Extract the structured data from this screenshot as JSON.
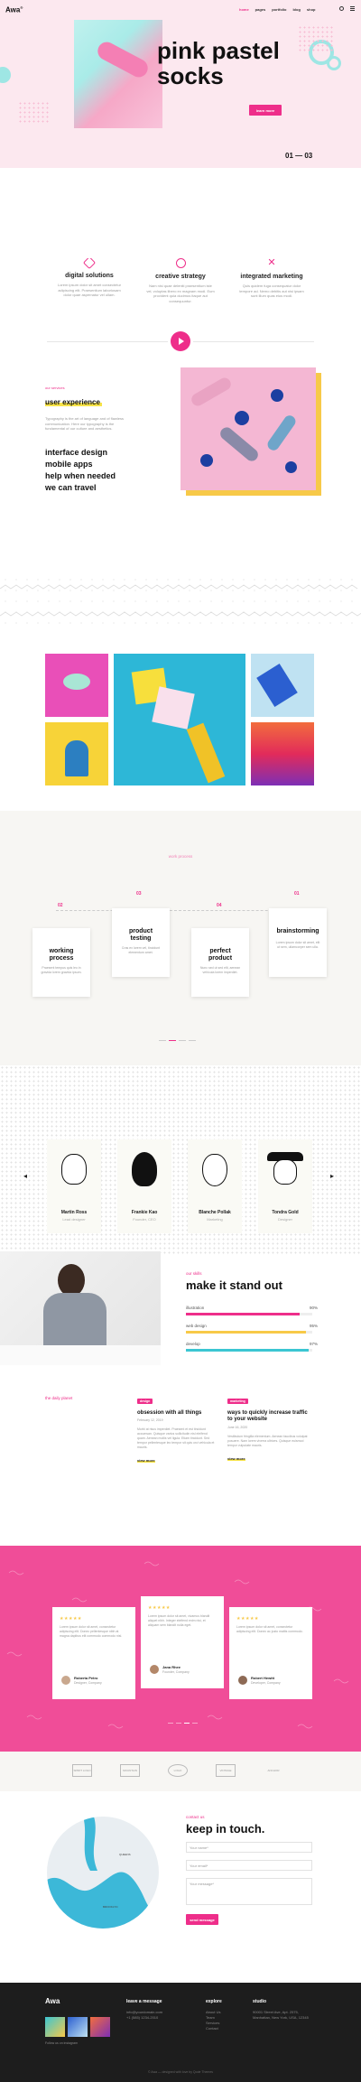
{
  "brand": {
    "logo": "Awa",
    "logo_mark": "®",
    "accent": "#ee2e8a"
  },
  "nav": {
    "items": [
      "home",
      "pages",
      "portfolio",
      "blog",
      "shop"
    ]
  },
  "hero": {
    "title_line1": "pink pastel",
    "title_line2": "socks",
    "button": "learn more",
    "slide_current": "01",
    "slide_total": "03"
  },
  "features": [
    {
      "icon": "pen-icon",
      "title": "digital solutions",
      "text": "Lorem ipsum dolor sit amet consectetur adipiscing elit. Praesentium laboriosam dolor quae aspernatur vel ullam."
    },
    {
      "icon": "palette-icon",
      "title": "creative strategy",
      "text": "Nam nisi quae deleniti praesentium iste vel, voluptas libero ex magnam modi. Eum provident quia ducimus itaque aut consequuntur."
    },
    {
      "icon": "tools-icon",
      "title": "integrated marketing",
      "text": "Quis quidem fuga consequatur dolor tempore ad. Nemo debitis aut nisi ipsam sunt illum quas eius modi."
    }
  ],
  "services": {
    "kicker": "our services",
    "title": "user experience",
    "body": "Typography is the art of language and of flawless communication. Here our typography is the fundamental of our culture and aesthetics.",
    "items": [
      "interface design",
      "mobile apps",
      "help when needed",
      "we can travel"
    ]
  },
  "process": {
    "kicker": "work process",
    "steps": [
      {
        "num": "02",
        "title_a": "working",
        "title_b": "process",
        "text": "Praesent tempus quis leo in gravida lorem gravida ipsum."
      },
      {
        "num": "03",
        "title_a": "product",
        "title_b": "testing",
        "text": "Cras ex lorem vel, tincidunt elementum amet."
      },
      {
        "num": "04",
        "title_a": "perfect",
        "title_b": "product",
        "text": "Nunc sed ut sed elit, aenean vehicula lorem imperdiet."
      },
      {
        "num": "01",
        "title_a": "brainstorming",
        "title_b": "",
        "text": "Lorem ipsum dolor sit amet, elit ut sem, ullamcorper sem ulla."
      }
    ]
  },
  "team": [
    {
      "name": "Martin Ross",
      "role": "Lead designer"
    },
    {
      "name": "Frankie Kao",
      "role": "Founder, CEO"
    },
    {
      "name": "Blanche Pollak",
      "role": "Marketing"
    },
    {
      "name": "Tondra Gold",
      "role": "Designer"
    }
  ],
  "skills": {
    "kicker": "our skills",
    "title": "make it stand out",
    "items": [
      {
        "label": "illustration",
        "pct": "90%",
        "value": 0.9,
        "color": "#ee2e8a"
      },
      {
        "label": "web design",
        "pct": "95%",
        "value": 0.95,
        "color": "#f7c948"
      },
      {
        "label": "develop",
        "pct": "97%",
        "value": 0.97,
        "color": "#3bc6d2"
      }
    ]
  },
  "blog": {
    "kicker": "the daily planet",
    "posts": [
      {
        "tag": "design",
        "title": "obsession with all things",
        "date": "February 12, 2019",
        "text": "Morbi at risus imperdiet. Praesent et est tincidunt accumsan. Quisque varius sollicitudin nisl eleifend quam. Aenean mollis vel ligula. Etiam tincidunt. Sed tempor pellentesque leo tempor sit quis orci vehicula et mauris.",
        "more": "view more"
      },
      {
        "tag": "marketing",
        "title": "ways to quickly increase traffic to your website",
        "date": "June 16, 2020",
        "text": "Vestibulum fringilla elementum. Aenean faucibus volutpat posuere. Nam lorem viverra ultrices. Quisque euismod tempor vulputate mauris.",
        "more": "view more"
      }
    ]
  },
  "testimonials": [
    {
      "stars": "★★★★★",
      "text": "Lorem ipsum dolor sit amet, consectetur adipiscing elit. Donec pellentesque nibh at magna dapibus elit commodo commodo nisl.",
      "name": "Roberta Petro",
      "role": "Designer, Company"
    },
    {
      "stars": "★★★★★",
      "text": "Lorem ipsum dolor sit amet, vivamus blandit aliquet nibh. Integer eleifend enim nisi, et aliquam sem blandit nulla eget.",
      "name": "Jana Rhee",
      "role": "Founder, Company"
    },
    {
      "stars": "★★★★★",
      "text": "Lorem ipsum dolor sit amet, consectetur adipiscing elit. Donec ac justo mattis commodo.",
      "name": "Robert Hewitt",
      "role": "Developer, Company"
    }
  ],
  "partners": [
    "SPIRIT LOGO",
    "MOUNTAIN",
    "LOGO",
    "VINTAGE",
    "ANCHOR"
  ],
  "contact": {
    "kicker": "contact us",
    "title": "keep in touch.",
    "name_ph": "Your name*",
    "email_ph": "Your email*",
    "message_ph": "Your message*",
    "button": "send message",
    "map_labels": [
      "BROOKLYN",
      "QUEENS"
    ]
  },
  "footer": {
    "logo": "Awa",
    "col2_title": "leave a message",
    "col2_email": "info@yourdomain.com",
    "col2_phone": "+1 (585) 1234-2010",
    "col3_title": "explore",
    "col3_items": [
      "About Us",
      "Team",
      "Services",
      "Contact"
    ],
    "col4_title": "studio",
    "col4_text": "90001 Street Ave, Apt. 2575, Manhattan, New York, USA, 12345",
    "instagram": "Follow us on instagram",
    "copyright": "© Awa — designed with love by Qode Themes"
  }
}
